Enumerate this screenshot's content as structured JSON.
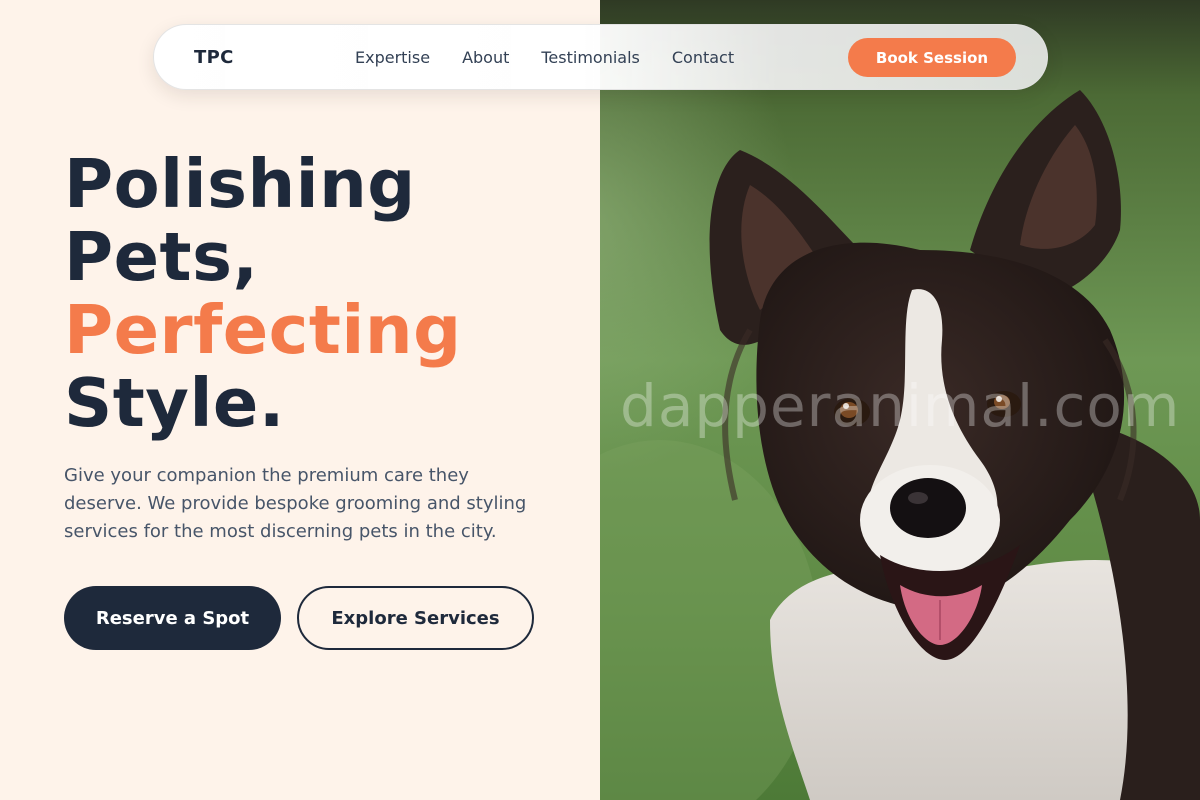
{
  "nav": {
    "brand": "TPC",
    "links": [
      "Expertise",
      "About",
      "Testimonials",
      "Contact"
    ],
    "cta": "Book Session"
  },
  "hero": {
    "headline_line1": "Polishing",
    "headline_line2": "Pets,",
    "headline_accent": "Perfecting",
    "headline_line4": "Style.",
    "subtitle": "Give your companion the premium care they deserve. We provide bespoke grooming and styling services for the most discerning pets in the city.",
    "primary_button": "Reserve a Spot",
    "secondary_button": "Explore Services"
  },
  "image": {
    "watermark": "dapperanimal.com",
    "subject": "border-collie-dog"
  },
  "colors": {
    "accent": "#f47b4b",
    "navy": "#1e293b",
    "background": "#fef3ea"
  }
}
